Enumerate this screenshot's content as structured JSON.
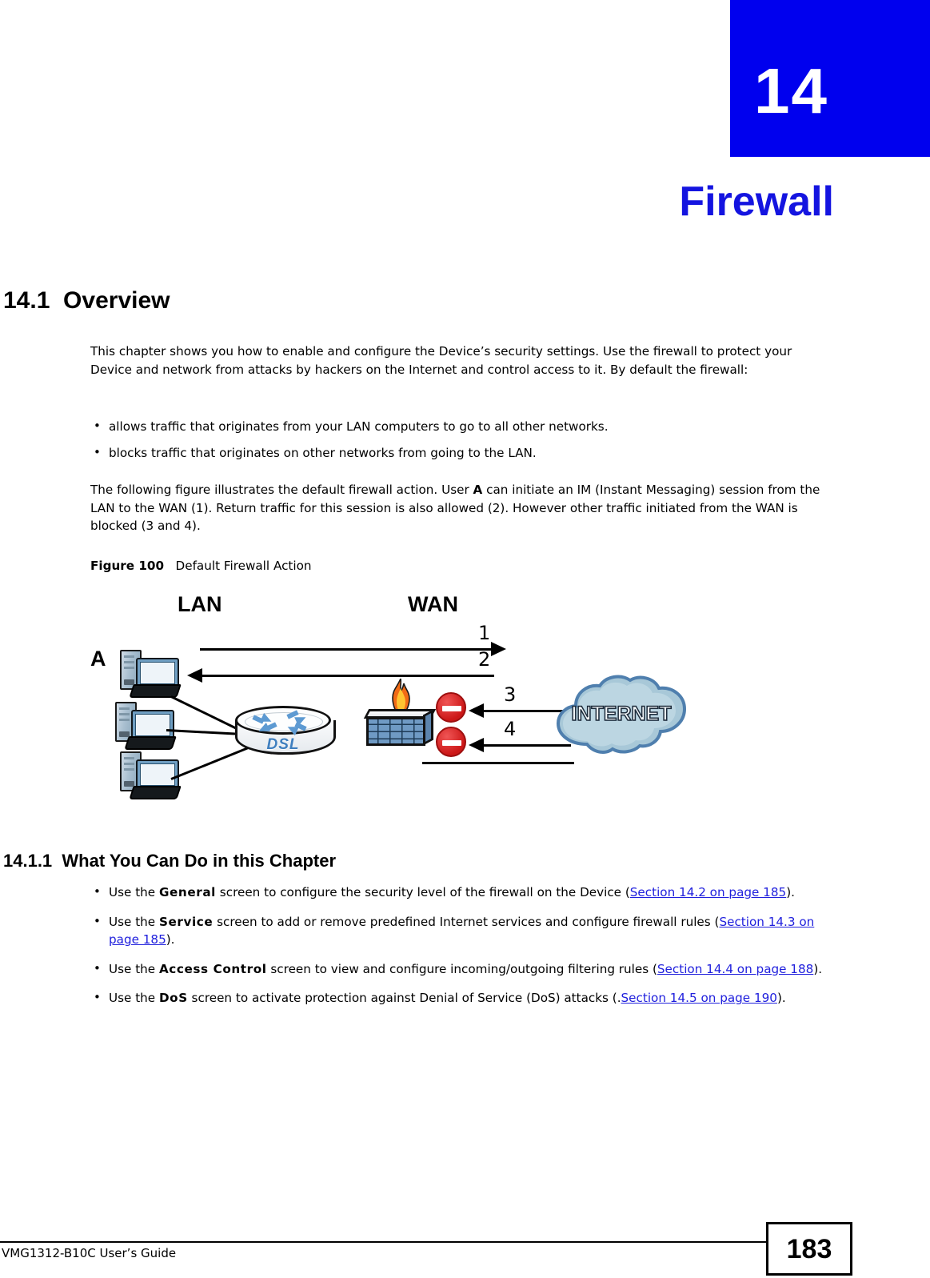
{
  "chapter": {
    "number": "14",
    "title": "Firewall",
    "banner_color": "#0000ee",
    "title_color": "#1414e0"
  },
  "sections": {
    "overview": {
      "heading": "14.1  Overview",
      "intro_paragraph": "This chapter shows you how to enable and configure the Device’s security settings. Use the firewall to protect your Device and network from attacks by hackers on the Internet and control access to it. By default the firewall:",
      "default_behaviour": [
        "allows traffic that originates from your LAN computers to go to all other networks.",
        "blocks traffic that originates on other networks from going to the LAN."
      ],
      "figure_intro": {
        "part1": "The following figure illustrates the default firewall action. User ",
        "bold": "A",
        "part2": " can initiate an IM (Instant Messaging) session from the LAN to the WAN (1). Return traffic for this session is also allowed (2). However other traffic initiated from the WAN is blocked (3 and 4)."
      }
    },
    "what_you_can_do": {
      "heading": "14.1.1  What You Can Do in this Chapter",
      "items": [
        {
          "pre": "Use the ",
          "ui": "General",
          "mid": " screen to configure the security level of the firewall on the Device (",
          "xref": "Section 14.2 on page 185",
          "post": ")."
        },
        {
          "pre": "Use the ",
          "ui": "Service",
          "mid": " screen to add or remove predefined Internet services and configure firewall rules (",
          "xref": "Section 14.3 on page 185",
          "post": ")."
        },
        {
          "pre": "Use the ",
          "ui": "Access Control",
          "mid": " screen to view and configure incoming/outgoing filtering rules (",
          "xref": "Section 14.4 on page 188",
          "post": ")."
        },
        {
          "pre": "Use the ",
          "ui": "DoS",
          "mid": " screen to activate protection against Denial of Service (DoS) attacks (.",
          "xref": "Section 14.5 on page 190",
          "post": ")."
        }
      ]
    }
  },
  "figure": {
    "label": "Figure 100",
    "caption": "Default Firewall Action",
    "diagram": {
      "lan_label": "LAN",
      "wan_label": "WAN",
      "user_label": "A",
      "router_label": "DSL",
      "cloud_label": "INTERNET",
      "flows": [
        {
          "id": "1",
          "direction": "lan-to-wan",
          "allowed": true
        },
        {
          "id": "2",
          "direction": "wan-to-lan",
          "allowed": true
        },
        {
          "id": "3",
          "direction": "wan-to-lan",
          "allowed": false
        },
        {
          "id": "4",
          "direction": "wan-to-lan",
          "allowed": false
        }
      ],
      "pc_count": 3,
      "blocked_sign_count": 2
    }
  },
  "footer": {
    "guide_name": "VMG1312-B10C User’s Guide",
    "page_number": "183"
  }
}
